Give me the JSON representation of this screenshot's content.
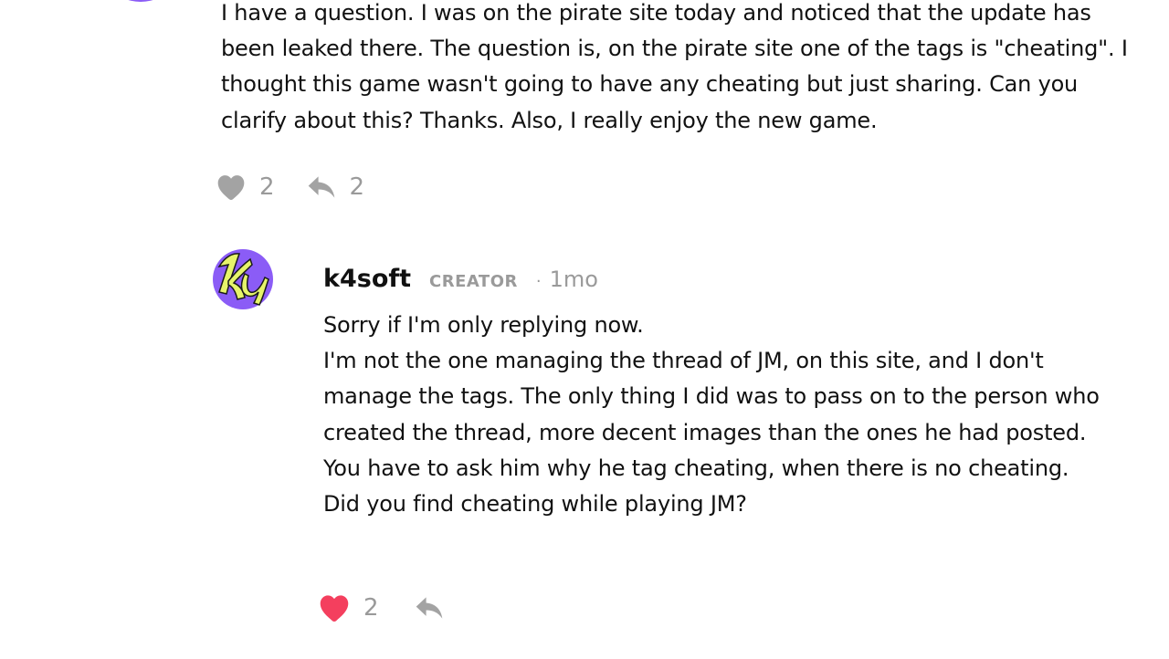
{
  "parent_comment": {
    "body": "I have a question.  I was on the pirate site today and noticed that the update has been leaked there.  The question is, on the pirate site one of the tags is \"cheating\".  I thought this game wasn't going to have any cheating but just sharing.  Can you clarify about this?  Thanks.  Also, I really enjoy the new game.",
    "like_count": "2",
    "reply_count": "2"
  },
  "reply_comment": {
    "avatar_text": "K4",
    "author": "k4soft",
    "badge": "CREATOR",
    "separator": "·",
    "time": "1mo",
    "body": "Sorry if I'm only replying now.\nI'm not the one managing the thread of JM, on this site, and I don't manage the tags. The only thing I did was to pass on to the person who created the thread, more decent images than the ones he had posted.\nYou have to ask him why he tag cheating, when there is no cheating.\nDid you find cheating while playing JM?",
    "like_count": "2",
    "liked": true
  },
  "colors": {
    "liked_heart": "#f43f5e",
    "muted": "#9a9a9a",
    "avatar_purple": "#8b5cf6",
    "avatar_yellow": "#e6f46a"
  },
  "icons": {
    "like": "heart-icon",
    "reply": "reply-arrow-icon"
  }
}
